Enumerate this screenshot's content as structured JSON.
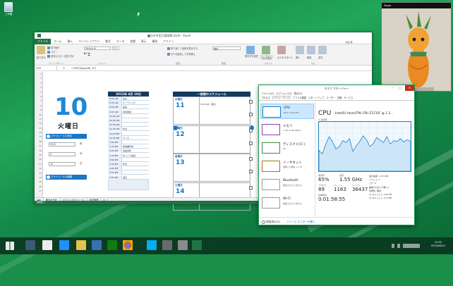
{
  "desktop": {
    "recycle_bin_label": "ごみ箱"
  },
  "excel": {
    "title": "■日の予定日管理表.xlsm - Excel",
    "tabs": [
      "ファイル",
      "ホーム",
      "挿入",
      "ページレイアウト",
      "数式",
      "データ",
      "校閲",
      "表示",
      "開発",
      "アドイン"
    ],
    "ribbon": {
      "paste": "貼り付け",
      "cut": "切り取り",
      "copy": "コピー",
      "format_painter": "書式のコピー/貼り付け",
      "clipboard": "クリップボード",
      "font_name": "Meiryo UI",
      "font_size": "11",
      "font_group": "フォント",
      "wrap": "折り返して全体を表示する",
      "merge": "セルを結合して中央揃え",
      "align_group": "配置",
      "number_format": "標準",
      "number_group": "数値",
      "cond_format": "条件付き書式",
      "table_format": "テーブルとして書式設定",
      "cell_styles": "セルのスタイル",
      "styles_group": "スタイル",
      "insert": "挿入",
      "delete": "削除",
      "format": "書式",
      "cells_group": "セル",
      "user": "大谷 麗"
    },
    "formula": {
      "name_box": "H33",
      "content": "=TEXT(Day(A6),\"d\")"
    },
    "calendar": {
      "day_number": "10",
      "day_of_week": "火曜日",
      "schedule_input_label": "スケジュールの表示",
      "year_value": "2012",
      "year_unit": "年",
      "month_value": "4",
      "month_unit": "月",
      "day_value": "10",
      "day_unit": "日",
      "schedule_edit_label": "スケジュールの編集"
    },
    "timeline": {
      "header": "2012年 4月 10日",
      "rows": [
        {
          "time": "8:00 AM",
          "text": "出社"
        },
        {
          "time": "8:30 AM",
          "text": "ミーティング"
        },
        {
          "time": "9:00 AM",
          "text": "会議"
        },
        {
          "time": "9:30 AM",
          "text": "資料確認"
        },
        {
          "time": "10:00 AM",
          "text": ""
        },
        {
          "time": "10:30 AM",
          "text": ""
        },
        {
          "time": "11:00 AM",
          "text": ""
        },
        {
          "time": "11:30 AM",
          "text": "外出"
        },
        {
          "time": "12:00 PM",
          "text": ""
        },
        {
          "time": "12:30 PM",
          "text": "ランチ"
        },
        {
          "time": "1:00 PM",
          "text": ""
        },
        {
          "time": "1:30 PM",
          "text": "報告書作成"
        },
        {
          "time": "2:00 PM",
          "text": "会議資料"
        },
        {
          "time": "2:30 PM",
          "text": "ゆっくり電話"
        },
        {
          "time": "3:00 PM",
          "text": ""
        },
        {
          "time": "3:30 PM",
          "text": "外出"
        },
        {
          "time": "4:00 PM",
          "text": ""
        },
        {
          "time": "4:30 PM",
          "text": ""
        },
        {
          "time": "5:00 PM",
          "text": "退社"
        }
      ]
    },
    "weekly": {
      "header": "一週間のスケジュール",
      "days": [
        {
          "name": "水曜日",
          "num": "11",
          "event": "9:30 AM　歓迎"
        },
        {
          "name": "木曜日",
          "num": "12",
          "event": ""
        },
        {
          "name": "金曜日",
          "num": "13",
          "event": ""
        },
        {
          "name": "土曜日",
          "num": "14",
          "event": ""
        }
      ]
    },
    "sheet_tabs": [
      "毎日の予定",
      "イベントスケジュール",
      "設定管理"
    ],
    "status": "準備完了"
  },
  "taskmgr": {
    "title": "タスク マネージャー",
    "menu": [
      "ファイル(F)",
      "オプション(O)",
      "表示(V)"
    ],
    "tabs": [
      "プロセス",
      "パフォーマンス",
      "アプリの履歴",
      "スタートアップ",
      "ユーザー",
      "詳細",
      "サービス"
    ],
    "items": [
      {
        "name": "CPU",
        "sub": "65%  1.55 GHz"
      },
      {
        "name": "メモリ",
        "sub": "1.3/1.9 GB (68%)"
      },
      {
        "name": "ディスク 0 (C:)",
        "sub": "0%"
      },
      {
        "name": "イーサネット",
        "sub": "送信: 0 受信: 1.1 M"
      },
      {
        "name": "Bluetooth",
        "sub": "接続されていません"
      },
      {
        "name": "Wi-Fi",
        "sub": "接続されていません"
      }
    ],
    "cpu": {
      "title": "CPU",
      "model": "Intel(R) Atom(TM) CPU Z3735F @ 1.3...",
      "graph_label": "% 使用率",
      "usage_label": "使用率",
      "usage": "65%",
      "speed_label": "速度",
      "speed": "1.55 GHz",
      "proc_label": "プロセス",
      "proc": "89",
      "threads_label": "スレッド",
      "threads": "1163",
      "handles_label": "ハンドル",
      "handles": "36437",
      "uptime_label": "稼働時間",
      "uptime": "0:01:58:55",
      "right": [
        "最大速度: 1.33 GHz",
        "ソケット: 1",
        "コア: 4",
        "論理プロセッサ数: 4",
        "仮想化: 無効",
        "L1 キャッシュ: 224 KB",
        "L2 キャッシュ: 2.0 MB"
      ],
      "usage_trace": [
        0.42,
        0.35,
        0.55,
        0.7,
        0.6,
        0.45,
        0.5,
        0.62,
        0.58,
        0.66,
        0.4,
        0.52,
        0.6,
        0.72,
        0.64,
        0.5,
        0.56,
        0.68,
        0.63,
        0.58,
        0.7,
        0.55,
        0.62,
        0.6,
        0.66,
        0.59,
        0.64,
        0.6
      ]
    },
    "footer": {
      "less": "簡易表示(D)",
      "monitor": "リソース モニターを開く"
    }
  },
  "camera": {
    "label": "Skype"
  },
  "taskbar": {
    "clock_time": "15:52",
    "clock_date": "2015/06/12"
  },
  "colors": {
    "excel_green": "#217346",
    "accent_blue": "#1b76c4",
    "header_navy": "#143a5e",
    "desktop_green": "#1a8f4a"
  }
}
